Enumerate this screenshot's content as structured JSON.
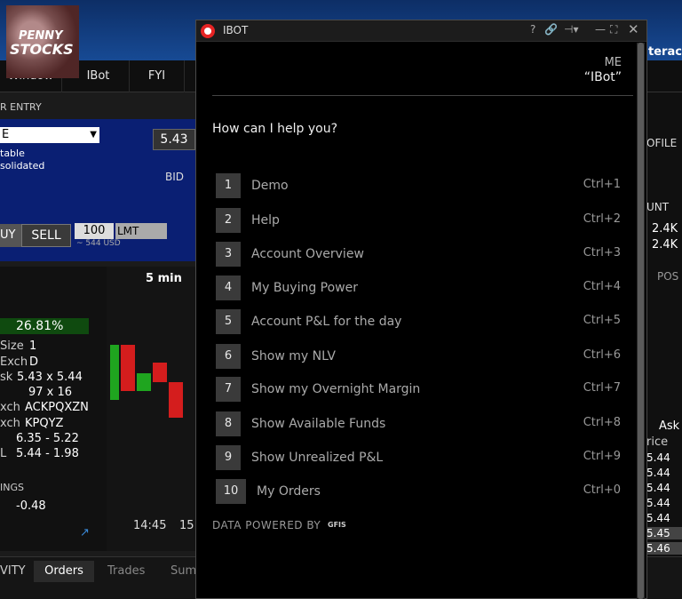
{
  "background": {
    "menu": [
      "Window",
      "IBot",
      "FYI"
    ],
    "order_entry_title": "R ENTRY",
    "order_type": "E",
    "bid_price": "5.43",
    "bid_label": "BID",
    "buy_label": "UY",
    "sell_label": "SELL",
    "quantity": "100",
    "order_kind": "LMT",
    "usd_note": "~ 544 USD",
    "pct_change": "26.81%",
    "quote_rows": [
      {
        "label": "Size",
        "value": "1"
      },
      {
        "label": "Exch",
        "value": "D"
      },
      {
        "label": "sk",
        "value": "5.43 x 5.44"
      },
      {
        "label": "",
        "value": "97 x 16"
      },
      {
        "label": "xch",
        "value": "ACKPQXZN"
      },
      {
        "label": "xch",
        "value": "KPQYZ"
      },
      {
        "label": "",
        "value": "6.35 - 5.22"
      },
      {
        "label": "L",
        "value": "5.44 - 1.98"
      }
    ],
    "earnings_label": "INGS",
    "earnings_value": "-0.48",
    "chart_interval": "5 min",
    "chart_times": [
      "14:45",
      "15"
    ],
    "bottom_tabs": [
      "VITY",
      "Orders",
      "Trades",
      "Sum"
    ],
    "right_labels": [
      "OFILE",
      "UNT",
      "2.4K",
      "2.4K",
      "POS",
      "Ask",
      "rice"
    ],
    "right_prices": [
      "5.44",
      "5.44",
      "5.44",
      "5.44",
      "5.44",
      "5.45",
      "5.46"
    ],
    "interactive_label": "teracti"
  },
  "penny": {
    "line1": "PENNY",
    "line2": "STOCKS"
  },
  "ibot": {
    "title": "IBOT",
    "help_icon": "?",
    "me_label": "ME",
    "me_value": "“IBot”",
    "prompt": "How can I help you?",
    "commands": [
      {
        "num": "1",
        "label": "Demo",
        "key": "Ctrl+1"
      },
      {
        "num": "2",
        "label": "Help",
        "key": "Ctrl+2"
      },
      {
        "num": "3",
        "label": "Account Overview",
        "key": "Ctrl+3"
      },
      {
        "num": "4",
        "label": "My Buying Power",
        "key": "Ctrl+4"
      },
      {
        "num": "5",
        "label": "Account P&L for the day",
        "key": "Ctrl+5"
      },
      {
        "num": "6",
        "label": "Show my NLV",
        "key": "Ctrl+6"
      },
      {
        "num": "7",
        "label": "Show my Overnight Margin",
        "key": "Ctrl+7"
      },
      {
        "num": "8",
        "label": "Show Available Funds",
        "key": "Ctrl+8"
      },
      {
        "num": "9",
        "label": "Show Unrealized P&L",
        "key": "Ctrl+9"
      },
      {
        "num": "10",
        "label": "My Orders",
        "key": "Ctrl+0"
      }
    ],
    "powered_by": "DATA POWERED BY",
    "powered_brand": "GFIS"
  },
  "colors": {
    "accent_red": "#e52323",
    "order_panel_blue": "#0a1f73",
    "gain_green": "#1a7a1a"
  },
  "icons": [
    "help-icon",
    "link-icon",
    "pin-icon",
    "minimize-icon",
    "maximize-icon",
    "close-icon"
  ]
}
